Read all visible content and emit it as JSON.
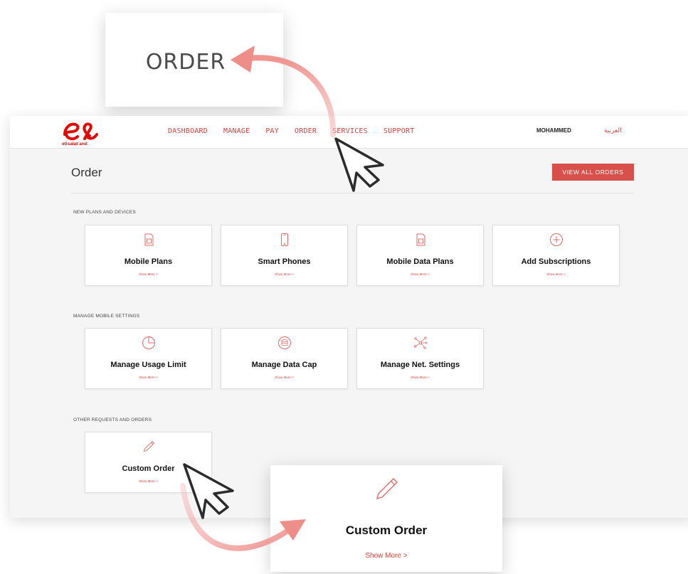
{
  "callout_top": {
    "label": "ORDER"
  },
  "header": {
    "logo_text": "etisalat and",
    "nav": [
      "DASHBOARD",
      "MANAGE",
      "PAY",
      "ORDER",
      "SERVICES",
      "SUPPORT"
    ],
    "user": "MOHAMMED",
    "lang": "العربية"
  },
  "page": {
    "title": "Order",
    "view_all": "VIEW ALL ORDERS"
  },
  "sections": [
    {
      "label": "NEW PLANS AND DEVICES",
      "cards": [
        {
          "title": "Mobile Plans",
          "more": "Show More  >",
          "icon": "sim-card-icon"
        },
        {
          "title": "Smart Phones",
          "more": "Show More  >",
          "icon": "smartphone-icon"
        },
        {
          "title": "Mobile Data Plans",
          "more": "Show More  >",
          "icon": "sim-card-icon"
        },
        {
          "title": "Add Subscriptions",
          "more": "Show More  >",
          "icon": "plus-circle-icon"
        }
      ]
    },
    {
      "label": "MANAGE MOBILE SETTINGS",
      "cards": [
        {
          "title": "Manage Usage Limit",
          "more": "Show More  >",
          "icon": "pie-chart-icon"
        },
        {
          "title": "Manage Data Cap",
          "more": "Show More  >",
          "icon": "database-icon"
        },
        {
          "title": "Manage Net. Settings",
          "more": "Show More  >",
          "icon": "network-icon"
        }
      ]
    },
    {
      "label": "OTHER REQUESTS AND ORDERS",
      "cards": [
        {
          "title": "Custom Order",
          "more": "Show More  >",
          "icon": "pencil-icon"
        }
      ]
    }
  ],
  "callout_bottom": {
    "title": "Custom Order",
    "more": "Show More  >"
  },
  "colors": {
    "accent": "#d7504a",
    "nav": "#d3433e",
    "brand": "#e00800",
    "arrow": "#f2b0ad"
  }
}
